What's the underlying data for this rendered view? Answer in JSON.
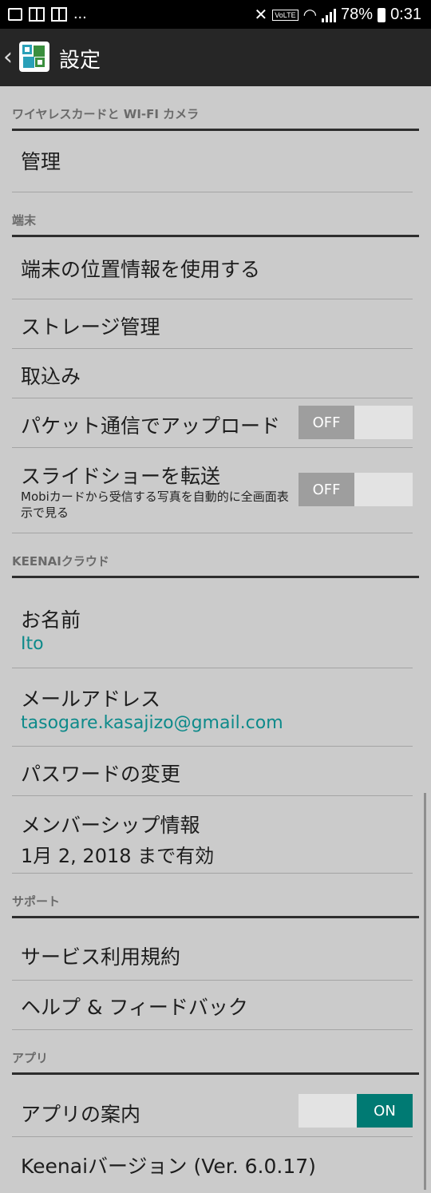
{
  "status_bar": {
    "battery": "78%",
    "time": "0:31",
    "notif_more": "...",
    "volte": "VoLTE"
  },
  "app_bar": {
    "title": "設定"
  },
  "sections": {
    "wireless": {
      "header": "ワイヤレスカードと WI-FI カメラ",
      "manage": "管理"
    },
    "device": {
      "header": "端末",
      "location": "端末の位置情報を使用する",
      "storage": "ストレージ管理",
      "import": "取込み",
      "packet_upload": "パケット通信でアップロード",
      "packet_upload_state": "OFF",
      "slideshow": "スライドショーを転送",
      "slideshow_desc": "Mobiカードから受信する写真を自動的に全画面表示で見る",
      "slideshow_state": "OFF"
    },
    "cloud": {
      "header": "KEENAIクラウド",
      "name_label": "お名前",
      "name_value": "Ito",
      "email_label": "メールアドレス",
      "email_value": "tasogare.kasajizo@gmail.com",
      "password_change": "パスワードの変更",
      "membership_label": "メンバーシップ情報",
      "membership_value": "1月 2, 2018 まで有効"
    },
    "support": {
      "header": "サポート",
      "terms": "サービス利用規約",
      "help": "ヘルプ & フィードバック"
    },
    "app": {
      "header": "アプリ",
      "guide": "アプリの案内",
      "guide_state": "ON",
      "version": "Keenaiバージョン (Ver. 6.0.17)"
    }
  },
  "colors": {
    "background": "#cbcbcb",
    "app_bar": "#262626",
    "accent": "#007a73",
    "link_text": "#0d8a8a"
  }
}
